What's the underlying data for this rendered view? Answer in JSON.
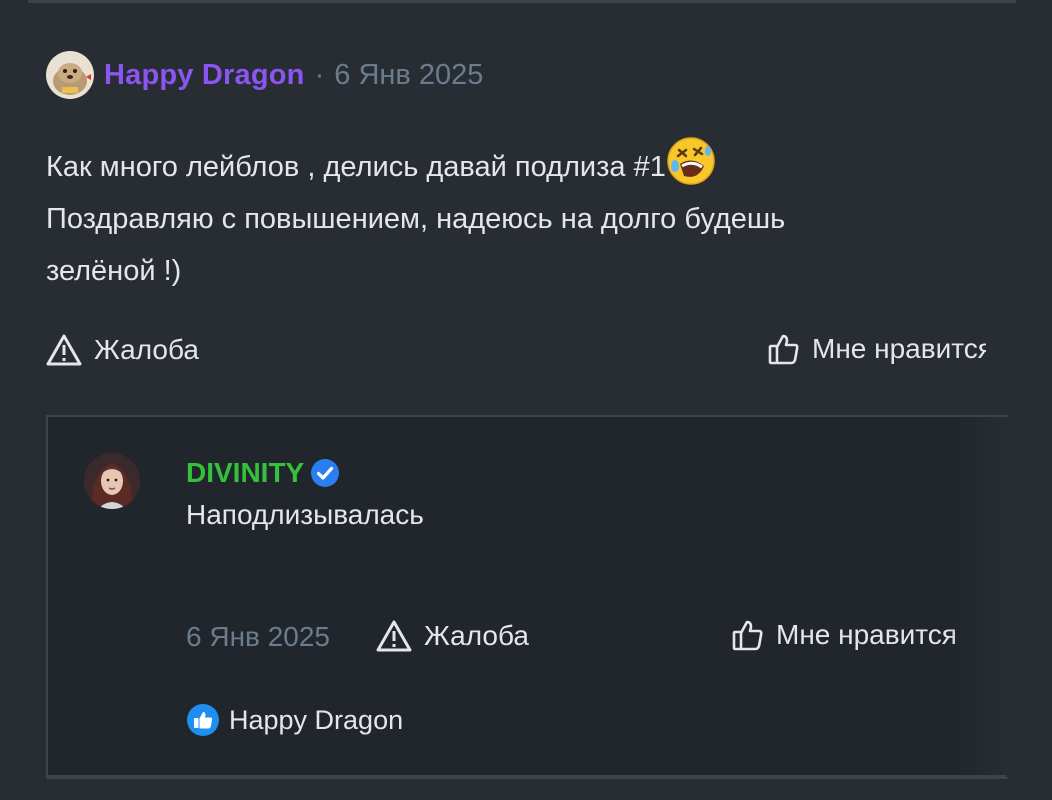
{
  "post": {
    "author": "Happy Dragon",
    "separator": "·",
    "date": "6 Янв 2025",
    "avatar_icon": "seal-avatar",
    "lines": [
      "Как много лейблов , делись давай подлиза #1",
      "Поздравляю с повышением, надеюсь на долго будешь",
      "зелёной !)"
    ],
    "emoji": "rolling-on-floor-laughing-emoji",
    "report_label": "Жалоба",
    "like_label": "Мне нравится"
  },
  "reply": {
    "author": "DIVINITY",
    "verified_icon": "verified-badge-icon",
    "text": "Наподлизывалась",
    "date": "6 Янв 2025",
    "report_label": "Жалоба",
    "like_label": "Мне нравится",
    "liked_by": "Happy Dragon"
  },
  "colors": {
    "background": "#272d33",
    "reply_background": "#21262c",
    "author_purple": "#8a55f0",
    "author_green": "#33c23a",
    "muted": "#6c7c8c",
    "verified_blue": "#2a7ff0"
  }
}
